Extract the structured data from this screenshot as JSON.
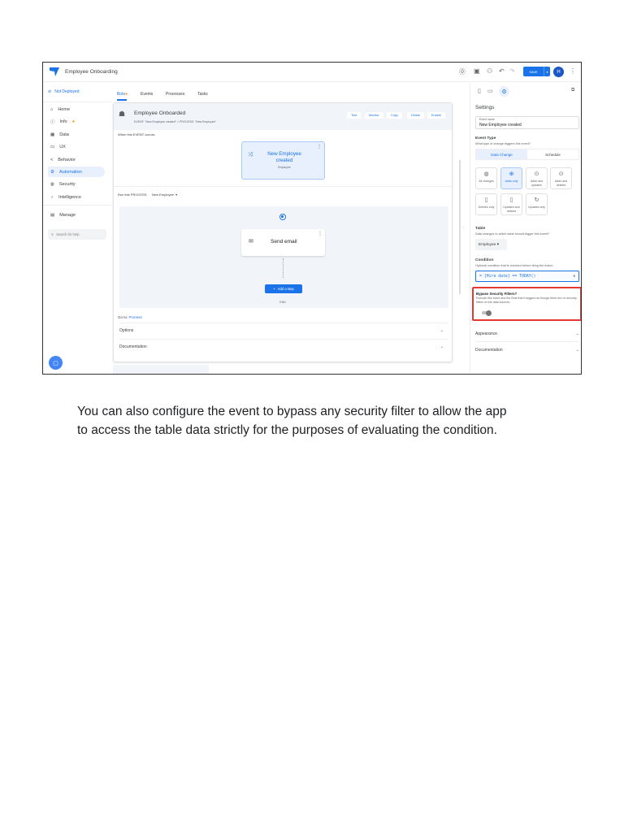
{
  "app": {
    "title": "Employee Onboarding",
    "save_label": "SAVE",
    "avatar_initial": "H"
  },
  "sidebar": {
    "deploy_status": "Not Deployed",
    "items": [
      {
        "label": "Home"
      },
      {
        "label": "Info"
      },
      {
        "label": "Data"
      },
      {
        "label": "UX"
      },
      {
        "label": "Behavior"
      },
      {
        "label": "Automation"
      },
      {
        "label": "Security"
      },
      {
        "label": "Intelligence"
      },
      {
        "label": "Manage"
      }
    ],
    "search_placeholder": "Search for help"
  },
  "tabs": [
    {
      "label": "Bots"
    },
    {
      "label": "Events"
    },
    {
      "label": "Processes"
    },
    {
      "label": "Tasks"
    }
  ],
  "bot": {
    "title": "Employee Onboarded",
    "subtitle": "EVENT: \"New Employee created\" > PROCESS: \"New Employee\"",
    "actions": [
      "Test",
      "Monitor",
      "Copy",
      "Delete",
      "Enable"
    ],
    "event_label": "When this EVENT occurs:",
    "event_card_title": "New Employee created",
    "event_card_sub": "Employee",
    "process_label": "Run this PROCESS:",
    "process_value": "New Employee",
    "step_label": "Send email",
    "add_step_label": "Add a step",
    "end_label": "END",
    "goto_label": "Go to:",
    "goto_link": "Process",
    "sections": [
      "Options",
      "Documentation"
    ]
  },
  "settings": {
    "title": "Settings",
    "event_name_label": "Event name",
    "event_name_value": "New Employee created",
    "event_type_title": "Event Type",
    "event_type_desc": "What type of change triggers this event?",
    "segments": [
      "Data Change",
      "Schedule"
    ],
    "tiles": [
      "All changes",
      "Adds only",
      "Adds and updates",
      "Adds and deletes",
      "Deletes only",
      "Updates and deletes",
      "Updates only"
    ],
    "table_title": "Table",
    "table_desc": "Data changes to which table should trigger this event?",
    "table_value": "Employee",
    "condition_title": "Condition",
    "condition_desc": "Optional condition that is checked before firing the Action",
    "condition_value": "[Hire date] == TODAY()",
    "bypass_title": "Bypass Security Filters?",
    "bypass_desc": "Execute this event and the Bots that it triggers as though there are no security filters on the data sources.",
    "bypass_enabled": false,
    "sections": [
      "Appearance",
      "Documentation"
    ]
  },
  "caption": {
    "line1": "You can also configure the event to bypass any security filter to allow the app",
    "line2": "to access the table data strictly for the purposes of evaluating the condition."
  },
  "colors": {
    "accent": "#1a73e8",
    "highlight": "#e53935"
  }
}
